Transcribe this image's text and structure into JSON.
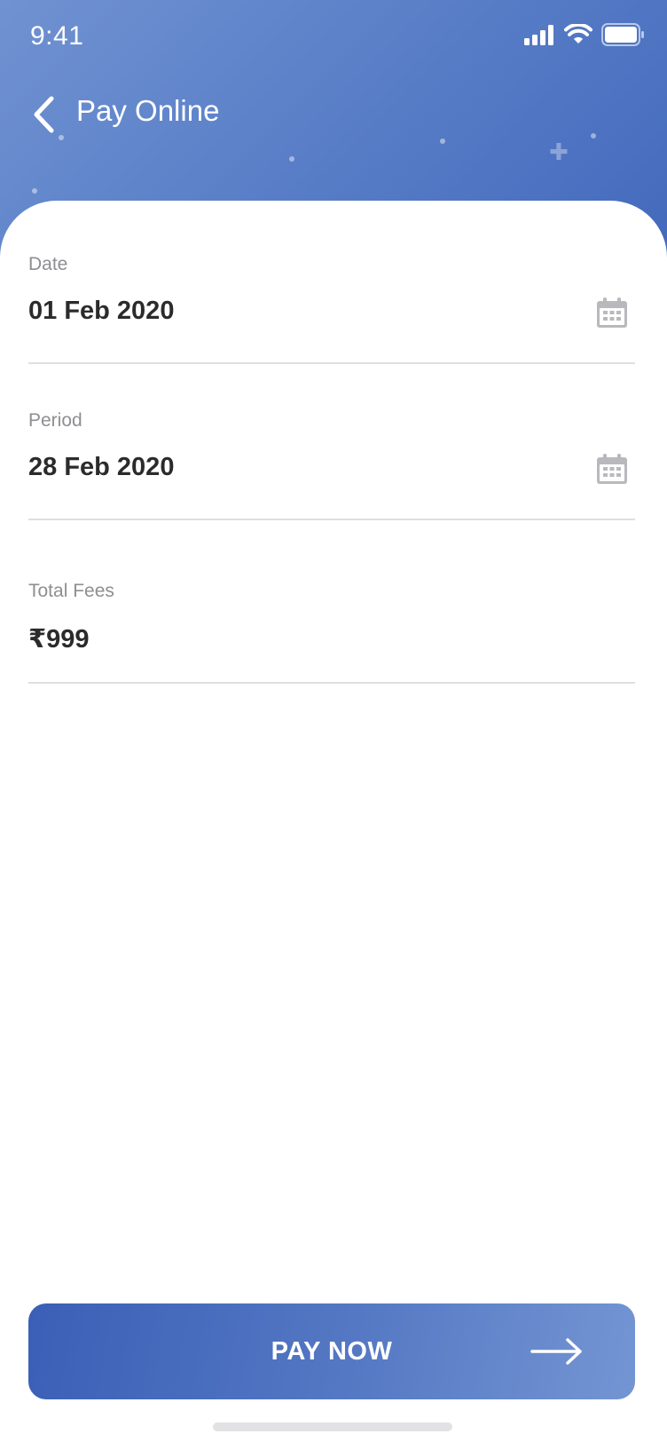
{
  "status_bar": {
    "time": "9:41"
  },
  "header": {
    "title": "Pay Online"
  },
  "fields": {
    "date": {
      "label": "Date",
      "value": "01 Feb 2020"
    },
    "period": {
      "label": "Period",
      "value": "28 Feb 2020"
    },
    "total_fees": {
      "label": "Total Fees",
      "value": "₹999"
    }
  },
  "actions": {
    "pay_now_label": "PAY NOW"
  },
  "icons": {
    "back": "chevron-left-icon",
    "calendar": "calendar-icon",
    "arrow": "arrow-right-icon"
  },
  "colors": {
    "header_gradient_start": "#7092d2",
    "header_gradient_end": "#4369bd",
    "button_gradient_start": "#3a5fb6",
    "button_gradient_end": "#7495d3",
    "label_gray": "#8e8e93",
    "value_dark": "#2b2b2b"
  }
}
